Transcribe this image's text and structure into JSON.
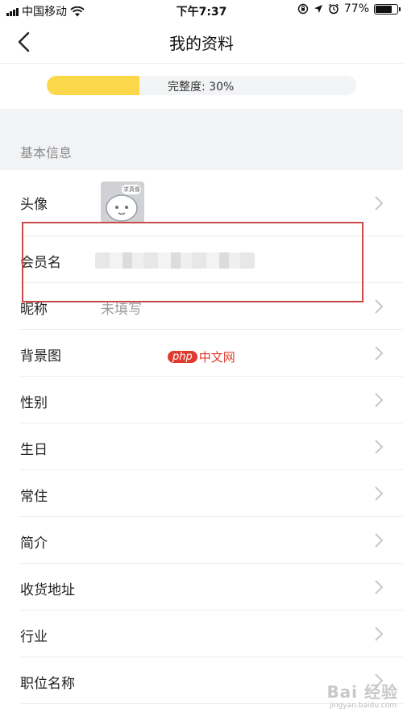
{
  "status_bar": {
    "carrier": "中国移动",
    "time": "下午7:37",
    "battery": "77%",
    "battery_level": 0.77
  },
  "navbar": {
    "title": "我的资料",
    "back_icon": "chevron-left-icon"
  },
  "profile_completeness": {
    "label": "完整度: 30%",
    "value": 0.3,
    "fill_color": "#fbd84a"
  },
  "section": {
    "title": "基本信息"
  },
  "rows": [
    {
      "key": "avatar",
      "label": "头像",
      "value": "",
      "avatar_text": "求真像"
    },
    {
      "key": "member-name",
      "label": "会员名",
      "value": ""
    },
    {
      "key": "nickname",
      "label": "昵称",
      "value": "未填写"
    },
    {
      "key": "background",
      "label": "背景图",
      "value": ""
    },
    {
      "key": "gender",
      "label": "性别",
      "value": ""
    },
    {
      "key": "birthday",
      "label": "生日",
      "value": ""
    },
    {
      "key": "residence",
      "label": "常住",
      "value": ""
    },
    {
      "key": "bio",
      "label": "简介",
      "value": ""
    },
    {
      "key": "address",
      "label": "收货地址",
      "value": ""
    },
    {
      "key": "industry",
      "label": "行业",
      "value": ""
    },
    {
      "key": "job-title",
      "label": "职位名称",
      "value": ""
    }
  ],
  "watermark": {
    "pill": "php",
    "text": "中文网"
  },
  "baidu_watermark": {
    "text": "Bai 经验",
    "sub": "jingyan.baidu.com"
  },
  "colors": {
    "accent": "#fbd84a",
    "highlight_box": "#c94a4a"
  }
}
